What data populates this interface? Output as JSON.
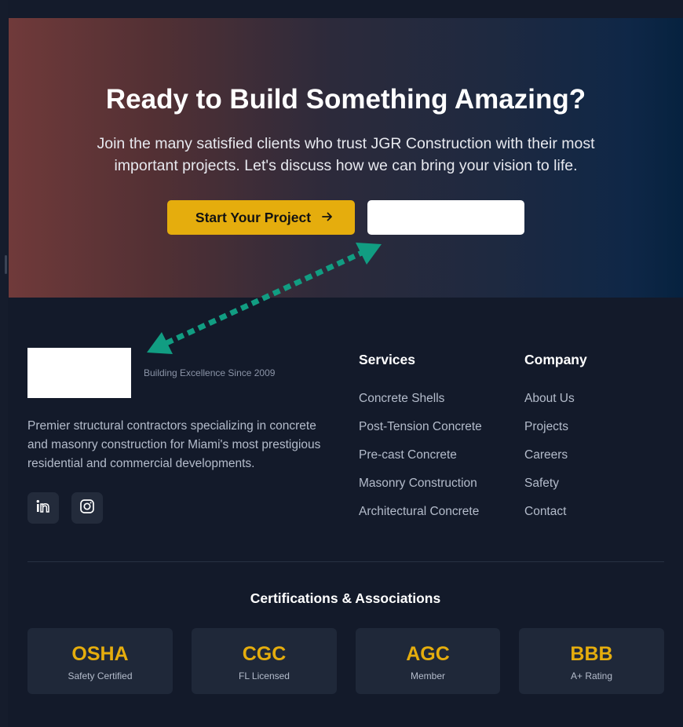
{
  "hero": {
    "title": "Ready to Build Something Amazing?",
    "subtitle_line1": "Join the many satisfied clients who trust JGR Construction with their most",
    "subtitle_line2": "important projects. Let's discuss how we can bring your vision to life.",
    "primary_button": "Start Your Project",
    "primary_button_icon": "arrow-right-icon",
    "secondary_button": ""
  },
  "footer": {
    "tagline": "Building Excellence Since 2009",
    "description_line1": "Premier structural contractors specializing in concrete",
    "description_line2": "and masonry construction for Miami's most prestigious",
    "description_line3": "residential and commercial developments.",
    "social": [
      "linkedin-icon",
      "instagram-icon"
    ],
    "services": {
      "heading": "Services",
      "items": [
        "Concrete Shells",
        "Post-Tension Concrete",
        "Pre-cast Concrete",
        "Masonry Construction",
        "Architectural Concrete"
      ]
    },
    "company": {
      "heading": "Company",
      "items": [
        "About Us",
        "Projects",
        "Careers",
        "Safety",
        "Contact"
      ]
    }
  },
  "certifications": {
    "title": "Certifications & Associations",
    "items": [
      {
        "name": "OSHA",
        "label": "Safety Certified"
      },
      {
        "name": "CGC",
        "label": "FL Licensed"
      },
      {
        "name": "AGC",
        "label": "Member"
      },
      {
        "name": "BBB",
        "label": "A+ Rating"
      }
    ]
  },
  "colors": {
    "accent": "#e5ad0d",
    "background": "#131a2a",
    "card": "#1f2839",
    "annotation_arrow": "#119d82"
  }
}
